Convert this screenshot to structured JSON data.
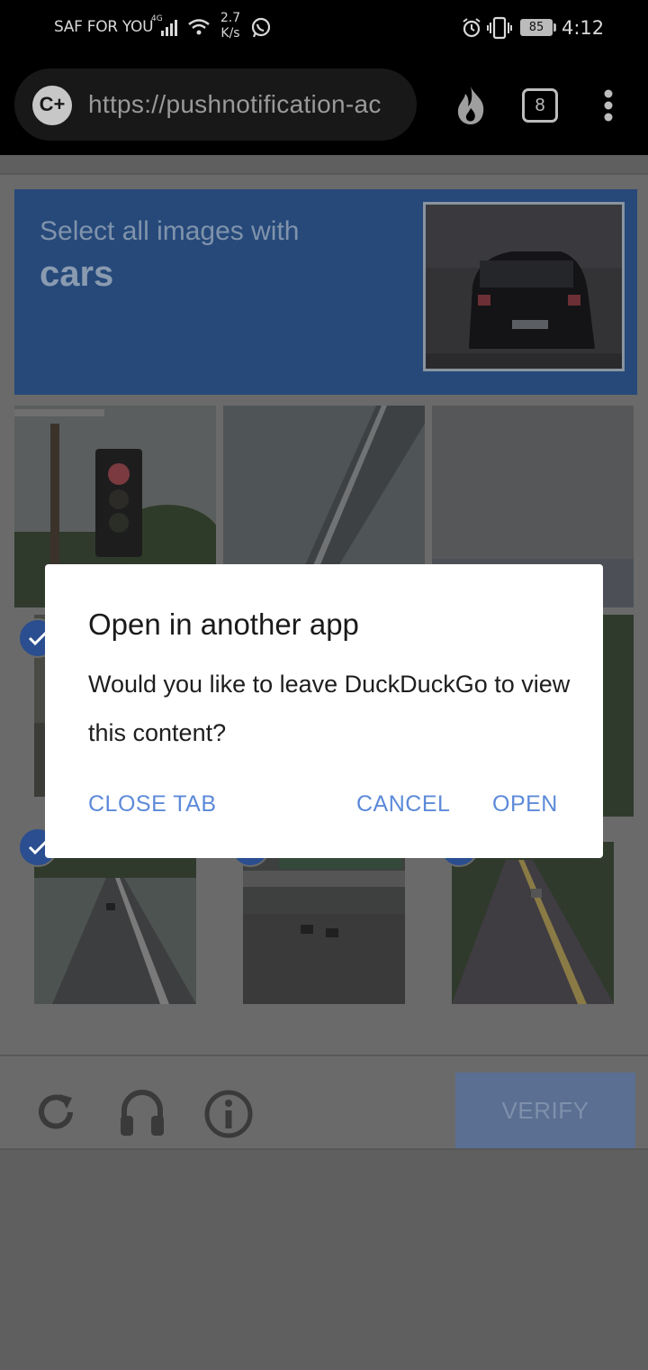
{
  "status_bar": {
    "carrier": "SAF FOR YOU",
    "network_type": "4G",
    "speed_value": "2.7",
    "speed_unit": "K/s",
    "battery": "85",
    "time": "4:12"
  },
  "browser": {
    "url": "https://pushnotification-ac",
    "tab_count": "8",
    "icons": [
      "duckduckgo-logo-icon",
      "fire-icon",
      "tabs-icon",
      "overflow-menu-icon"
    ]
  },
  "captcha": {
    "instruction": "Select all images with",
    "target": "cars",
    "verify_label": "VERIFY",
    "footer_icons": [
      "reload-icon",
      "headphones-icon",
      "info-icon"
    ],
    "tiles": [
      {
        "row": 1,
        "col": 1,
        "selected": false
      },
      {
        "row": 1,
        "col": 2,
        "selected": false
      },
      {
        "row": 1,
        "col": 3,
        "selected": false
      },
      {
        "row": 2,
        "col": 1,
        "selected": true
      },
      {
        "row": 2,
        "col": 2,
        "selected": false
      },
      {
        "row": 2,
        "col": 3,
        "selected": false
      },
      {
        "row": 3,
        "col": 1,
        "selected": true
      },
      {
        "row": 3,
        "col": 2,
        "selected": true
      },
      {
        "row": 3,
        "col": 3,
        "selected": true
      }
    ]
  },
  "dialog": {
    "title": "Open in another app",
    "message": "Would you like to leave DuckDuckGo to view this content?",
    "close_tab": "CLOSE TAB",
    "cancel": "CANCEL",
    "open": "OPEN"
  },
  "colors": {
    "accent": "#5d8ad9",
    "captcha_header": "#26497a",
    "check": "#2a4e8f"
  }
}
